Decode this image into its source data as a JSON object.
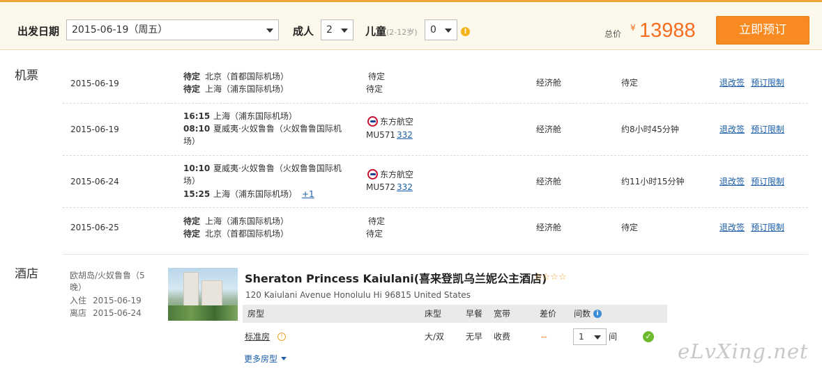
{
  "search": {
    "date_label": "出发日期",
    "date_value": "2015-06-19（周五）",
    "adult_label": "成人",
    "adult_value": "2",
    "child_label": "儿童",
    "child_sub": "(2-12岁)",
    "child_value": "0",
    "total_label": "总价",
    "currency": "¥",
    "total_value": "13988",
    "book_button": "立即预订"
  },
  "flights": {
    "section_title": "机票",
    "cabin": "经济舱",
    "change_link": "退改签",
    "limit_link": "预订限制",
    "rows": [
      {
        "date": "2015-06-19",
        "dep_time": "待定",
        "dep_place": "北京（首都国际机场）",
        "arr_time": "待定",
        "arr_place": "上海（浦东国际机场）",
        "flight_line1": "待定",
        "flight_line2": "待定",
        "duration": "待定"
      },
      {
        "date": "2015-06-19",
        "dep_time": "16:15",
        "dep_place": "上海（浦东国际机场）",
        "arr_time": "08:10",
        "arr_place": "夏威夷·火奴鲁鲁（火奴鲁鲁国际机",
        "arr_place_cont": "场）",
        "airline": "东方航空",
        "flight_no": "MU571",
        "plane": "332",
        "duration": "约8小时45分钟"
      },
      {
        "date": "2015-06-24",
        "dep_time": "10:10",
        "dep_place": "夏威夷·火奴鲁鲁（火奴鲁鲁国际机",
        "dep_place_cont": "场）",
        "arr_time": "15:25",
        "arr_place": "上海（浦东国际机场）",
        "day_offset": "+1",
        "airline": "东方航空",
        "flight_no": "MU572",
        "plane": "332",
        "duration": "约11小时15分钟"
      },
      {
        "date": "2015-06-25",
        "dep_time": "待定",
        "dep_place": "上海（浦东国际机场）",
        "arr_time": "待定",
        "arr_place": "北京（首都国际机场）",
        "flight_line1": "待定",
        "flight_line2": "待定",
        "duration": "待定"
      }
    ]
  },
  "hotel": {
    "section_title": "酒店",
    "location_line1": "欧胡岛/火奴鲁鲁（5",
    "location_line2": "晚）",
    "checkin_label": "入住",
    "checkin_date": "2015-06-19",
    "checkout_label": "离店",
    "checkout_date": "2015-06-24",
    "name": "Sheraton Princess Kaiulani(喜来登凯乌兰妮公主酒店)",
    "stars": "☆☆☆☆",
    "address": "120 Kaiulani Avenue Honolulu Hi 96815 United States",
    "table_headers": {
      "room_type": "房型",
      "bed": "床型",
      "breakfast": "早餐",
      "broadband": "宽带",
      "price_diff": "差价",
      "rooms": "间数"
    },
    "room": {
      "name": "标准房",
      "bed": "大/双",
      "breakfast": "无早",
      "broadband": "收费",
      "price_diff": "--",
      "rooms_value": "1",
      "rooms_unit": "间"
    },
    "more_rooms": "更多房型"
  },
  "watermark": "eLvXing.net"
}
